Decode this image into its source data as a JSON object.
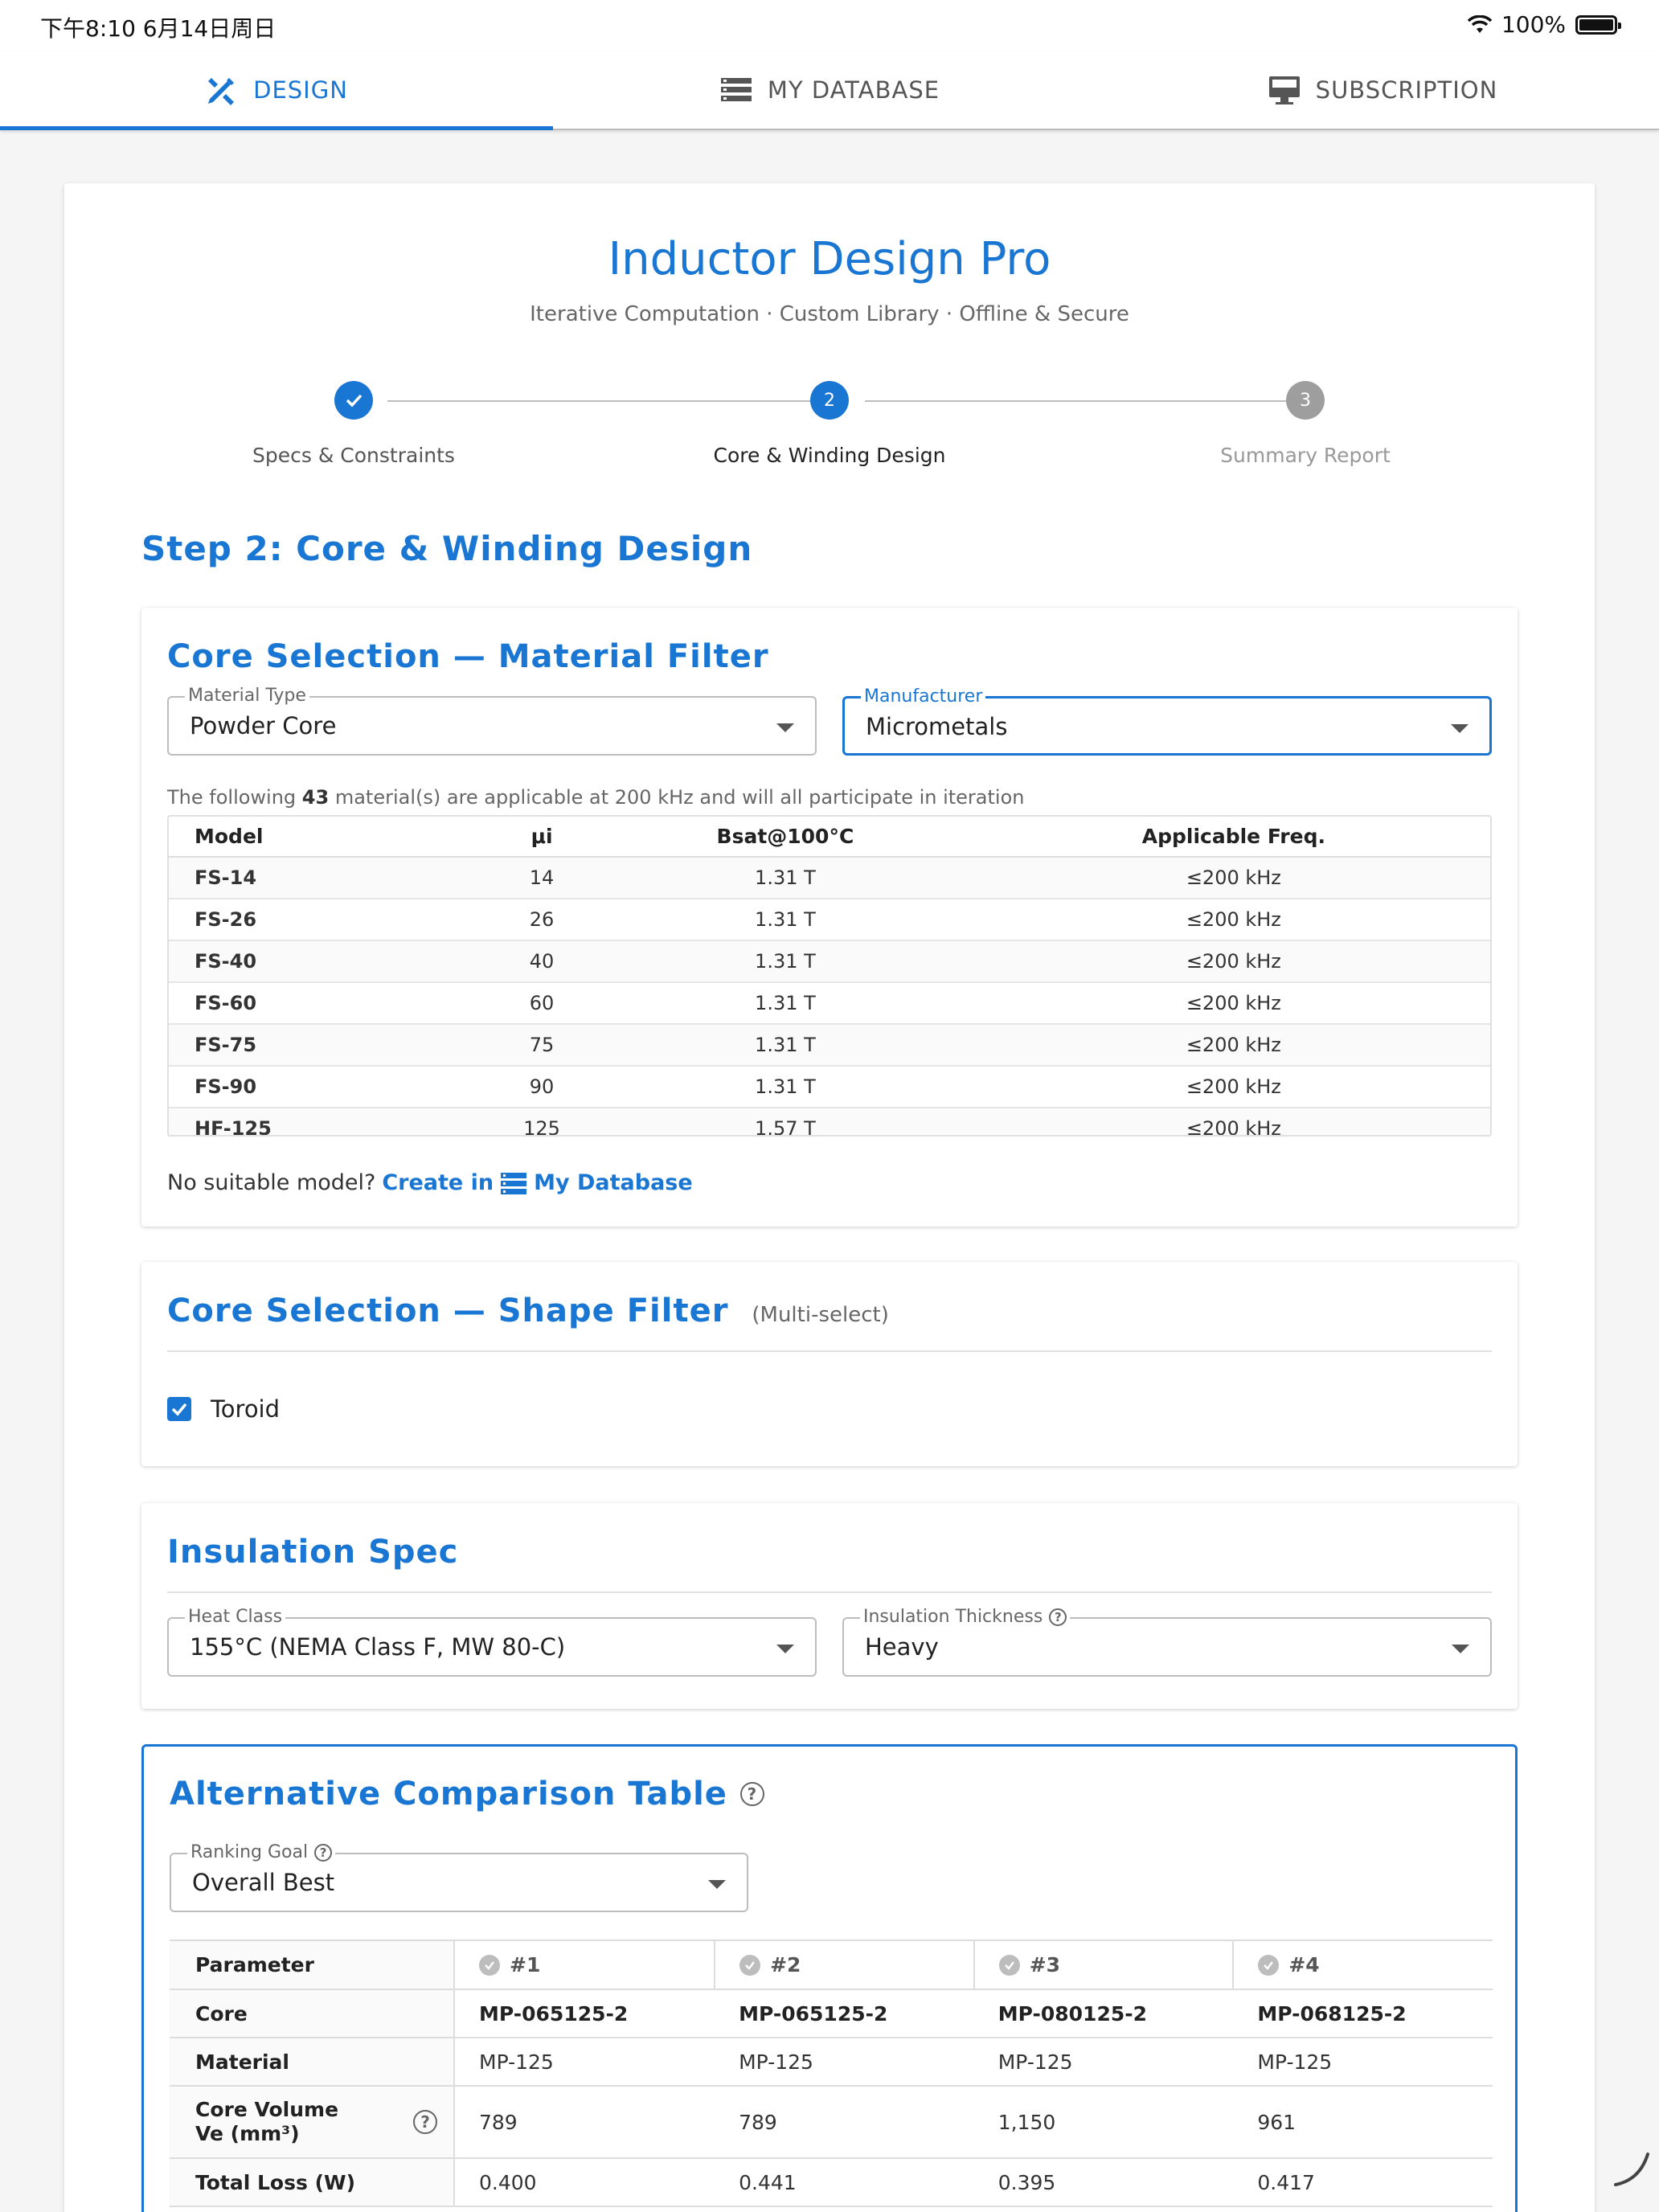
{
  "status_bar": {
    "time": "下午8:10   6月14日周日",
    "battery": "100%"
  },
  "tabs": [
    {
      "label": "DESIGN",
      "icon": "design-tools-icon",
      "active": true
    },
    {
      "label": "MY DATABASE",
      "icon": "database-list-icon",
      "active": false
    },
    {
      "label": "SUBSCRIPTION",
      "icon": "subscription-icon",
      "active": false
    }
  ],
  "header": {
    "title": "Inductor Design Pro",
    "subtitle": "Iterative Computation · Custom Library · Offline & Secure"
  },
  "stepper": {
    "steps": [
      {
        "number": "1",
        "label": "Specs & Constraints",
        "state": "completed"
      },
      {
        "number": "2",
        "label": "Core & Winding Design",
        "state": "active"
      },
      {
        "number": "3",
        "label": "Summary Report",
        "state": "pending"
      }
    ]
  },
  "step_heading": "Step 2: Core & Winding Design",
  "material_filter": {
    "title": "Core Selection — Material Filter",
    "material_type": {
      "label": "Material Type",
      "value": "Powder Core"
    },
    "manufacturer": {
      "label": "Manufacturer",
      "value": "Micrometals"
    },
    "hint_prefix": "The following ",
    "hint_count": "43",
    "hint_suffix": " material(s) are applicable at 200 kHz and will all participate in iteration",
    "columns": [
      "Model",
      "μi",
      "Bsat@100°C",
      "Applicable Freq."
    ],
    "rows": [
      [
        "FS-14",
        "14",
        "1.31 T",
        "≤200 kHz"
      ],
      [
        "FS-26",
        "26",
        "1.31 T",
        "≤200 kHz"
      ],
      [
        "FS-40",
        "40",
        "1.31 T",
        "≤200 kHz"
      ],
      [
        "FS-60",
        "60",
        "1.31 T",
        "≤200 kHz"
      ],
      [
        "FS-75",
        "75",
        "1.31 T",
        "≤200 kHz"
      ],
      [
        "FS-90",
        "90",
        "1.31 T",
        "≤200 kHz"
      ],
      [
        "HF-125",
        "125",
        "1.57 T",
        "≤200 kHz"
      ]
    ],
    "no_model_text": "No suitable model?",
    "create_in": "Create in",
    "my_database": "My Database"
  },
  "shape_filter": {
    "title": "Core Selection — Shape Filter",
    "note": "(Multi-select)",
    "options": [
      {
        "label": "Toroid",
        "checked": true
      }
    ]
  },
  "insulation": {
    "title": "Insulation Spec",
    "heat_class": {
      "label": "Heat Class",
      "value": "155°C (NEMA Class F, MW 80-C)"
    },
    "thickness": {
      "label": "Insulation Thickness",
      "value": "Heavy"
    }
  },
  "comparison": {
    "title": "Alternative Comparison Table",
    "ranking_goal": {
      "label": "Ranking Goal",
      "value": "Overall Best"
    },
    "header": [
      "Parameter",
      "#1",
      "#2",
      "#3",
      "#4"
    ],
    "rows": [
      {
        "param": "Core",
        "values": [
          "MP-065125-2",
          "MP-065125-2",
          "MP-080125-2",
          "MP-068125-2"
        ]
      },
      {
        "param": "Material",
        "values": [
          "MP-125",
          "MP-125",
          "MP-125",
          "MP-125"
        ]
      },
      {
        "param": "Core Volume Ve (mm³)",
        "values": [
          "789",
          "789",
          "1,150",
          "961"
        ]
      },
      {
        "param": "Total Loss (W)",
        "values": [
          "0.400",
          "0.441",
          "0.395",
          "0.417"
        ]
      }
    ]
  },
  "colors": {
    "accent": "#1976d2",
    "muted": "#9e9e9e"
  }
}
